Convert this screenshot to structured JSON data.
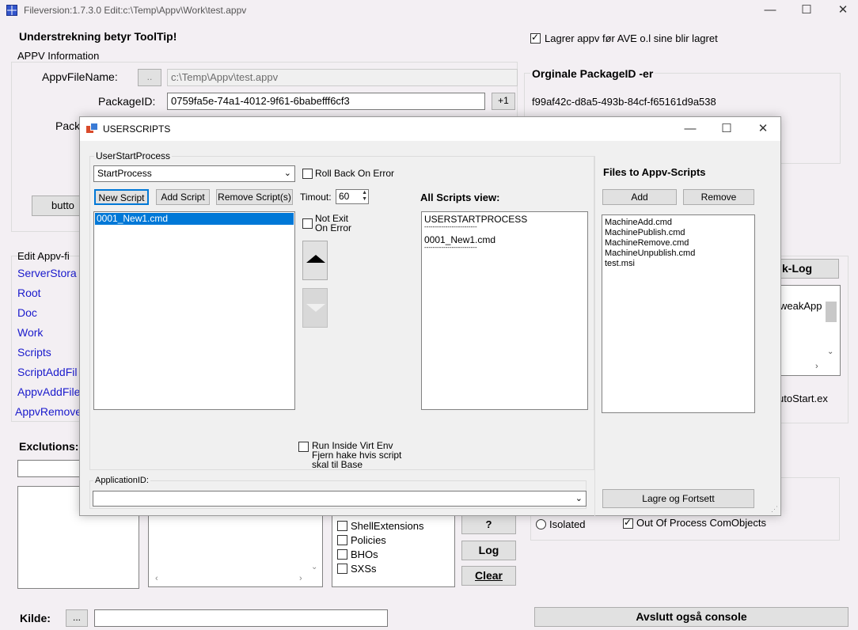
{
  "window": {
    "title": "Fileversion:1.7.3.0    Edit:c:\\Temp\\Appv\\Work\\test.appv",
    "minimize": "—",
    "maximize": "☐",
    "close": "✕"
  },
  "main": {
    "tooltip_note": "Understrekning betyr ToolTip!",
    "save_appv_check": "Lagrer appv før AVE o.l sine blir lagret",
    "appv_info_group": "APPV Information",
    "appv_filename_label": "AppvFileName:",
    "browse_button": "..",
    "appv_filename_value": "c:\\Temp\\Appv\\test.appv",
    "package_id_label": "PackageID:",
    "package_id_value": "0759fa5e-74a1-4012-9f61-6babefff6cf3",
    "plus_one": "+1",
    "original_pkg_header": "Orginale PackageID -er",
    "original_pkg_value": "f99af42c-d8a5-493b-84cf-f65161d9a538",
    "partial_label_pack": "Pack",
    "partial_button": "butto",
    "edit_group": "Edit Appv-fi",
    "edit_links": [
      "ServerStora",
      "Root",
      "Doc",
      "Work",
      "Scripts",
      "ScriptAddFil",
      "AppvAddFile",
      "AppvRemove"
    ],
    "k_log_button": "k-Log",
    "tweak_text": "weakApp",
    "autostart_text": "utoStart.ex",
    "exclutions_label": "Exclutions:",
    "checklist": [
      "ShellExtensions",
      "Policies",
      "BHOs",
      "SXSs"
    ],
    "question_button": "?",
    "log_button": "Log",
    "clear_button": "Clear",
    "isolated_radio": "Isolated",
    "out_of_process_check": "Out Of Process ComObjects",
    "kilde_label": "Kilde:",
    "kilde_browse": "...",
    "close_console_button": "Avslutt også console"
  },
  "dialog": {
    "title": "USERSCRIPTS",
    "minimize": "—",
    "maximize": "☐",
    "close": "✕",
    "user_start_group": "UserStartProcess",
    "process_combo": "StartProcess",
    "rollback_check": "Roll Back On Error",
    "new_script": "New Script",
    "add_script": "Add Script",
    "remove_scripts": "Remove Script(s)",
    "timeout_label": "Timout:",
    "timeout_value": "60",
    "script_list": [
      "0001_New1.cmd"
    ],
    "not_exit_line1": "Not Exit",
    "not_exit_line2": "On Error",
    "all_scripts_header": "All Scripts view:",
    "all_scripts_lines": [
      "USERSTARTPROCESS",
      "-------------------------",
      "0001_New1.cmd",
      "-------------------------"
    ],
    "files_header": "Files to Appv-Scripts",
    "files_add": "Add",
    "files_remove": "Remove",
    "files_list": [
      "MachineAdd.cmd",
      "MachinePublish.cmd",
      "MachineRemove.cmd",
      "MachineUnpublish.cmd",
      "test.msi"
    ],
    "run_inside_line1": "Run Inside Virt Env",
    "run_inside_line2": "Fjern hake  hvis  script",
    "run_inside_line3": "skal til Base",
    "app_id_label": "ApplicationID:",
    "save_continue": "Lagre og Fortsett"
  }
}
